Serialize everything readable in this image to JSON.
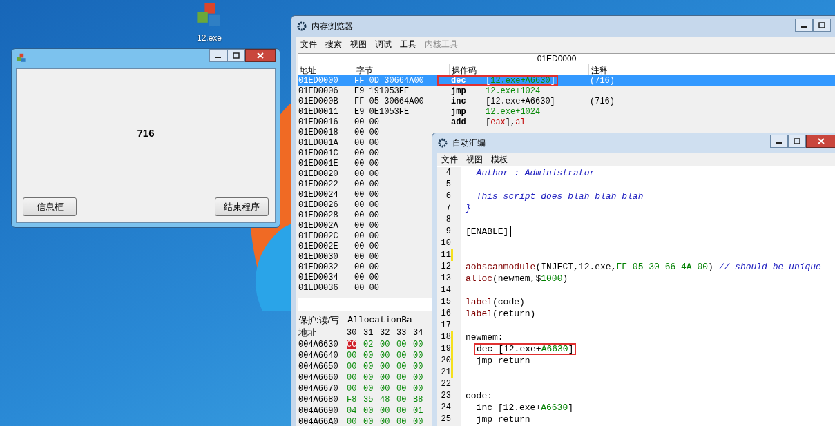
{
  "desktop_icon": {
    "label": "12.exe"
  },
  "app_window": {
    "value": "716",
    "buttons": [
      "信息框",
      "结束程序"
    ]
  },
  "memory_viewer": {
    "title": "内存浏览器",
    "menu": [
      {
        "label": "文件",
        "disabled": false
      },
      {
        "label": "搜索",
        "disabled": false
      },
      {
        "label": "视图",
        "disabled": false
      },
      {
        "label": "调试",
        "disabled": false
      },
      {
        "label": "工具",
        "disabled": false
      },
      {
        "label": "内核工具",
        "disabled": true
      }
    ],
    "address": "01ED0000",
    "columns": [
      "地址",
      "字节",
      "操作码",
      "注释"
    ],
    "rows": [
      {
        "address": "01ED0000",
        "bytes": "FF 0D 30664A00",
        "mnemonic": "dec",
        "operand": [
          {
            "text": "[",
            "kind": "plain"
          },
          {
            "text": "12.exe+A6630",
            "kind": "symbol"
          },
          {
            "text": "]",
            "kind": "plain"
          }
        ],
        "comment": "(716)",
        "selected": true,
        "boxed": true
      },
      {
        "address": "01ED0006",
        "bytes": "E9 191053FE",
        "mnemonic": "jmp",
        "operand": [
          {
            "text": "12.exe+1024",
            "kind": "symbol"
          }
        ],
        "selected": false,
        "boxed": false
      },
      {
        "address": "01ED000B",
        "bytes": "FF 05 30664A00",
        "mnemonic": "inc",
        "operand": [
          {
            "text": "[12.exe+A6630]",
            "kind": "plain"
          }
        ],
        "comment": "(716)",
        "selected": false,
        "boxed": false
      },
      {
        "address": "01ED0011",
        "bytes": "E9 0E1053FE",
        "mnemonic": "jmp",
        "operand": [
          {
            "text": "12.exe+1024",
            "kind": "symbol"
          }
        ],
        "selected": false,
        "boxed": false
      },
      {
        "address": "01ED0016",
        "bytes": "00 00",
        "mnemonic": "add",
        "operand": [
          {
            "text": "[",
            "kind": "plain"
          },
          {
            "text": "eax",
            "kind": "register"
          },
          {
            "text": "],",
            "kind": "plain"
          },
          {
            "text": "al",
            "kind": "register"
          }
        ],
        "selected": false,
        "boxed": false
      },
      {
        "address": "01ED0018",
        "bytes": "00 00",
        "selected": false
      },
      {
        "address": "01ED001A",
        "bytes": "00 00",
        "selected": false
      },
      {
        "address": "01ED001C",
        "bytes": "00 00",
        "selected": false
      },
      {
        "address": "01ED001E",
        "bytes": "00 00",
        "selected": false
      },
      {
        "address": "01ED0020",
        "bytes": "00 00",
        "selected": false
      },
      {
        "address": "01ED0022",
        "bytes": "00 00",
        "selected": false
      },
      {
        "address": "01ED0024",
        "bytes": "00 00",
        "selected": false
      },
      {
        "address": "01ED0026",
        "bytes": "00 00",
        "selected": false
      },
      {
        "address": "01ED0028",
        "bytes": "00 00",
        "selected": false
      },
      {
        "address": "01ED002A",
        "bytes": "00 00",
        "selected": false
      },
      {
        "address": "01ED002C",
        "bytes": "00 00",
        "selected": false
      },
      {
        "address": "01ED002E",
        "bytes": "00 00",
        "selected": false
      },
      {
        "address": "01ED0030",
        "bytes": "00 00",
        "selected": false
      },
      {
        "address": "01ED0032",
        "bytes": "00 00",
        "selected": false
      },
      {
        "address": "01ED0034",
        "bytes": "00 00",
        "selected": false
      },
      {
        "address": "01ED0036",
        "bytes": "00 00",
        "selected": false
      }
    ],
    "hex": {
      "protection": "保护:读/写",
      "allocation": "AllocationBa",
      "columns": [
        "地址",
        "30",
        "31",
        "32",
        "33",
        "34"
      ],
      "rows": [
        {
          "address": "004A6630",
          "bytes": [
            {
              "text": "CC",
              "changed": true
            },
            {
              "text": "02",
              "changed": false
            },
            {
              "text": "00",
              "changed": false
            },
            {
              "text": "00",
              "changed": false
            },
            {
              "text": "00",
              "changed": false
            }
          ]
        },
        {
          "address": "004A6640",
          "bytes": [
            {
              "text": "00",
              "changed": false
            },
            {
              "text": "00",
              "changed": false
            },
            {
              "text": "00",
              "changed": false
            },
            {
              "text": "00",
              "changed": false
            },
            {
              "text": "00",
              "changed": false
            }
          ]
        },
        {
          "address": "004A6650",
          "bytes": [
            {
              "text": "00",
              "changed": false
            },
            {
              "text": "00",
              "changed": false
            },
            {
              "text": "00",
              "changed": false
            },
            {
              "text": "00",
              "changed": false
            },
            {
              "text": "00",
              "changed": false
            }
          ]
        },
        {
          "address": "004A6660",
          "bytes": [
            {
              "text": "00",
              "changed": false
            },
            {
              "text": "00",
              "changed": false
            },
            {
              "text": "00",
              "changed": false
            },
            {
              "text": "00",
              "changed": false
            },
            {
              "text": "00",
              "changed": false
            }
          ]
        },
        {
          "address": "004A6670",
          "bytes": [
            {
              "text": "00",
              "changed": false
            },
            {
              "text": "00",
              "changed": false
            },
            {
              "text": "00",
              "changed": false
            },
            {
              "text": "00",
              "changed": false
            },
            {
              "text": "00",
              "changed": false
            }
          ]
        },
        {
          "address": "004A6680",
          "bytes": [
            {
              "text": "F8",
              "changed": false
            },
            {
              "text": "35",
              "changed": false
            },
            {
              "text": "48",
              "changed": false
            },
            {
              "text": "00",
              "changed": false
            },
            {
              "text": "B8",
              "changed": false
            }
          ]
        },
        {
          "address": "004A6690",
          "bytes": [
            {
              "text": "04",
              "changed": false
            },
            {
              "text": "00",
              "changed": false
            },
            {
              "text": "00",
              "changed": false
            },
            {
              "text": "00",
              "changed": false
            },
            {
              "text": "01",
              "changed": false
            }
          ]
        },
        {
          "address": "004A66A0",
          "bytes": [
            {
              "text": "00",
              "changed": false
            },
            {
              "text": "00",
              "changed": false
            },
            {
              "text": "00",
              "changed": false
            },
            {
              "text": "00",
              "changed": false
            },
            {
              "text": "00",
              "changed": false
            }
          ]
        }
      ]
    }
  },
  "auto_assembler": {
    "title": "自动汇编",
    "menu": [
      "文件",
      "视图",
      "模板"
    ],
    "lines": [
      {
        "number": "4",
        "modified": false,
        "tokens": [
          {
            "text": "  Author : Administrator",
            "kind": "comment"
          }
        ]
      },
      {
        "number": "5",
        "modified": false
      },
      {
        "number": "6",
        "modified": false,
        "tokens": [
          {
            "text": "  This script does blah blah blah",
            "kind": "comment"
          }
        ]
      },
      {
        "number": "7",
        "modified": false,
        "tokens": [
          {
            "text": "}",
            "kind": "comment"
          }
        ]
      },
      {
        "number": "8",
        "modified": false
      },
      {
        "number": "9",
        "modified": false,
        "cursor": true,
        "tokens": [
          {
            "text": "[ENABLE]",
            "kind": "plain"
          }
        ]
      },
      {
        "number": "10",
        "modified": false
      },
      {
        "number": "11",
        "modified": true
      },
      {
        "number": "12",
        "modified": false,
        "tokens": [
          {
            "text": "aobscanmodule",
            "kind": "keyword"
          },
          {
            "text": "(INJECT,12.exe,",
            "kind": "plain"
          },
          {
            "text": "FF 05 30 66 4A 00",
            "kind": "number"
          },
          {
            "text": ") ",
            "kind": "plain"
          },
          {
            "text": "// should be unique",
            "kind": "comment"
          }
        ]
      },
      {
        "number": "13",
        "modified": false,
        "tokens": [
          {
            "text": "alloc",
            "kind": "keyword"
          },
          {
            "text": "(newmem,$",
            "kind": "plain"
          },
          {
            "text": "1000",
            "kind": "number"
          },
          {
            "text": ")",
            "kind": "plain"
          }
        ]
      },
      {
        "number": "14",
        "modified": false
      },
      {
        "number": "15",
        "modified": false,
        "tokens": [
          {
            "text": "label",
            "kind": "keyword"
          },
          {
            "text": "(code)",
            "kind": "plain"
          }
        ]
      },
      {
        "number": "16",
        "modified": false,
        "tokens": [
          {
            "text": "label",
            "kind": "keyword"
          },
          {
            "text": "(return)",
            "kind": "plain"
          }
        ]
      },
      {
        "number": "17",
        "modified": false
      },
      {
        "number": "18",
        "modified": true,
        "tokens": [
          {
            "text": "newmem:",
            "kind": "plain"
          }
        ]
      },
      {
        "number": "19",
        "modified": true,
        "boxed": true,
        "tokens": [
          {
            "text": "dec [12.exe+",
            "kind": "plain"
          },
          {
            "text": "A6630",
            "kind": "number"
          },
          {
            "text": "]",
            "kind": "plain"
          }
        ]
      },
      {
        "number": "20",
        "modified": true,
        "tokens": [
          {
            "text": "  jmp return",
            "kind": "plain"
          }
        ]
      },
      {
        "number": "21",
        "modified": true
      },
      {
        "number": "22",
        "modified": false
      },
      {
        "number": "23",
        "modified": false,
        "tokens": [
          {
            "text": "code:",
            "kind": "plain"
          }
        ]
      },
      {
        "number": "24",
        "modified": false,
        "tokens": [
          {
            "text": "  inc [12.exe+",
            "kind": "plain"
          },
          {
            "text": "A6630",
            "kind": "number"
          },
          {
            "text": "]",
            "kind": "plain"
          }
        ]
      },
      {
        "number": "25",
        "modified": false,
        "tokens": [
          {
            "text": "  jmp return",
            "kind": "plain"
          }
        ]
      }
    ]
  }
}
